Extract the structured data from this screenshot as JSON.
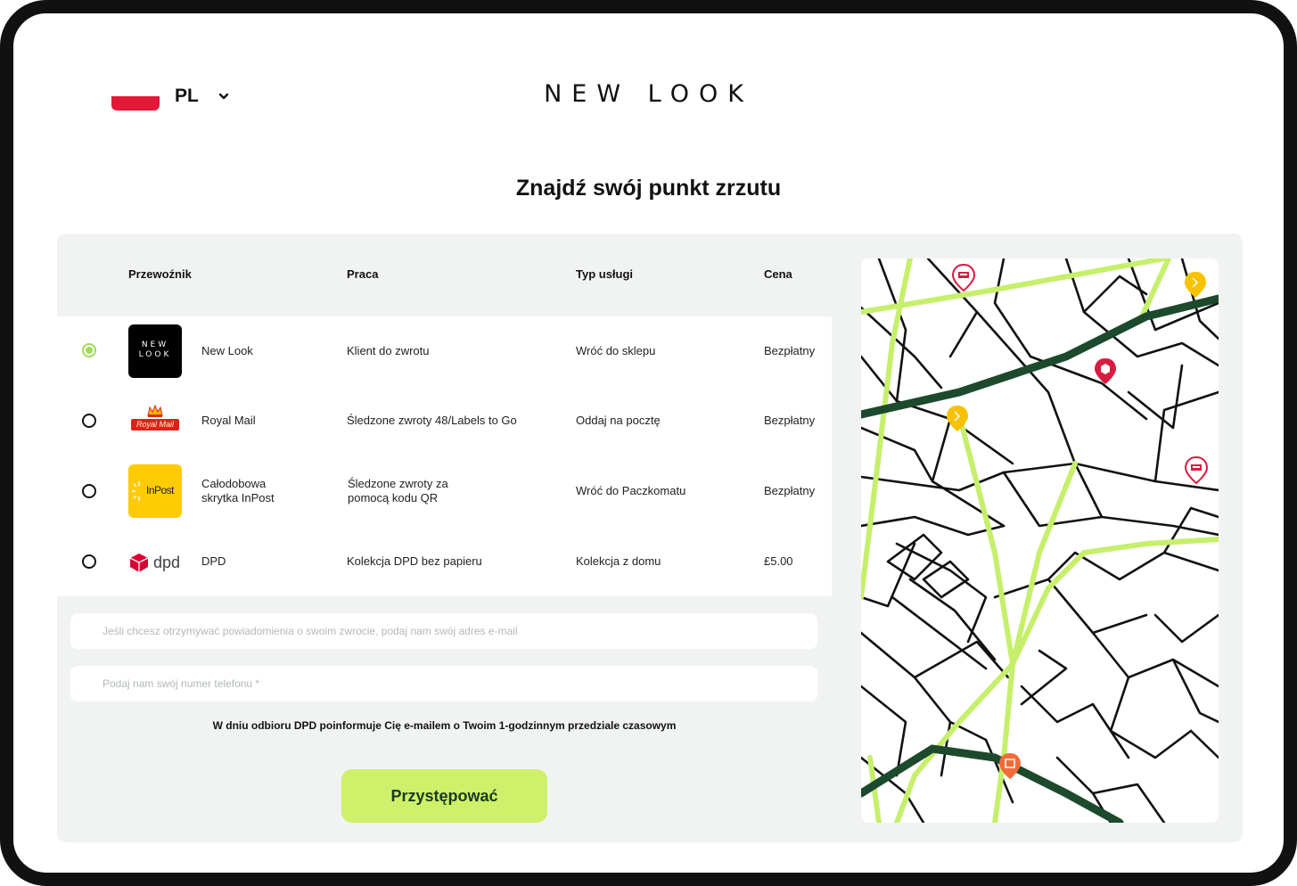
{
  "language": {
    "code": "PL"
  },
  "brand": {
    "logo_text": "NEW LOOK"
  },
  "page": {
    "title": "Znajdź swój punkt zrzutu"
  },
  "table": {
    "headers": {
      "carrier": "Przewoźnik",
      "work": "Praca",
      "service_type": "Typ usługi",
      "price": "Cena"
    },
    "rows": [
      {
        "carrier": "New Look",
        "work": "Klient do zwrotu",
        "service": "Wróć do sklepu",
        "price": "Bezpłatny",
        "logo_text_1": "NEW",
        "logo_text_2": "LOOK",
        "selected": true
      },
      {
        "carrier": "Royal Mail",
        "work": "Śledzone zwroty 48/Labels to Go",
        "service": "Oddaj na pocztę",
        "price": "Bezpłatny",
        "logo_text": "Royal Mail",
        "selected": false
      },
      {
        "carrier_line1": "Całodobowa",
        "carrier_line2": "skrytka InPost",
        "work_line1": "Śledzone zwroty za",
        "work_line2": "pomocą kodu QR",
        "service": "Wróć do Paczkomatu",
        "price": "Bezpłatny",
        "logo_text": "InPost",
        "selected": false
      },
      {
        "carrier": "DPD",
        "work": "Kolekcja DPD bez papieru",
        "service": "Kolekcja z domu",
        "price": "£5.00",
        "logo_text": "dpd",
        "selected": false
      }
    ]
  },
  "form": {
    "email_placeholder": "Jeśli chcesz otrzymywać powiadomienia o swoim zwrocie, podaj nam swój adres e-mail",
    "phone_placeholder": "Podaj nam swój numer telefonu *",
    "notice": "W dniu odbioru DPD poinformuje Cię e-mailem o Twoim 1-godzinnym przedziale czasowym",
    "proceed_label": "Przystępować"
  },
  "colors": {
    "accent": "#cff06a",
    "radio_selected": "#9fdb58",
    "panel_bg": "#f1f3f3",
    "map_road_main": "#1d4a2c",
    "map_road_secondary": "#c6ef6b",
    "pin_red": "#d81b40",
    "pin_yellow": "#f7c200",
    "pin_orange": "#f26a3a"
  },
  "map": {
    "pins": [
      {
        "icon": "post-box-icon",
        "color": "red"
      },
      {
        "icon": "inpost-locker-icon",
        "color": "yellow"
      },
      {
        "icon": "dpd-parcel-icon",
        "color": "red"
      },
      {
        "icon": "inpost-locker-icon",
        "color": "yellow"
      },
      {
        "icon": "post-box-icon",
        "color": "red"
      },
      {
        "icon": "shop-icon",
        "color": "orange"
      }
    ]
  }
}
